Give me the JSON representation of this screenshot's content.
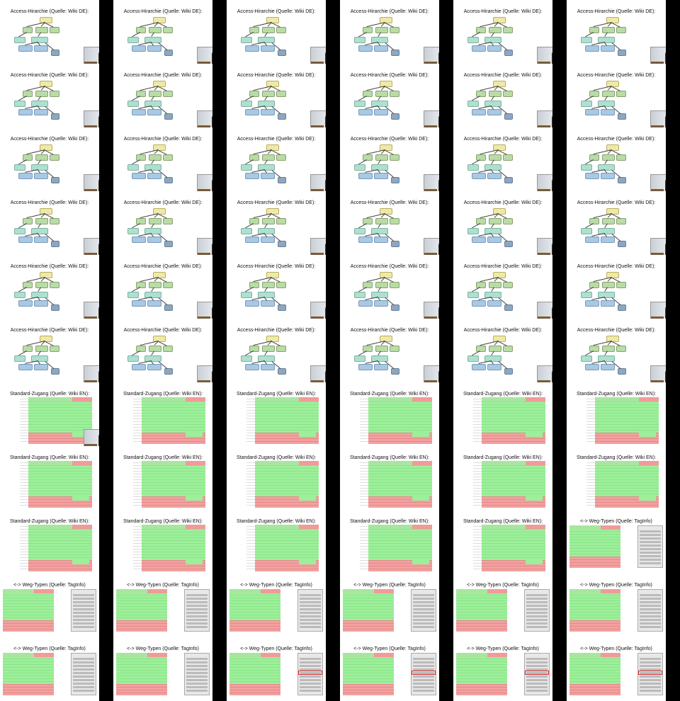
{
  "slides": {
    "access": {
      "title": "Access-Hirarchie (Quelle: Wiki DE):"
    },
    "standard": {
      "title": "Standard-Zugang (Quelle: Wiki EN):"
    },
    "weg": {
      "title": "<-> Weg-Typen (Quelle: TagInfo)"
    }
  },
  "layout_rows": [
    [
      "access",
      "access",
      "access",
      "access",
      "access",
      "access"
    ],
    [
      "access",
      "access",
      "access",
      "access",
      "access",
      "access"
    ],
    [
      "access",
      "access",
      "access",
      "access",
      "access",
      "access"
    ],
    [
      "access",
      "access",
      "access",
      "access",
      "access",
      "access"
    ],
    [
      "access",
      "access",
      "access",
      "access",
      "access",
      "access"
    ],
    [
      "access",
      "access",
      "access",
      "access",
      "access",
      "access"
    ],
    [
      "standard",
      "standard",
      "standard",
      "standard",
      "standard",
      "standard"
    ],
    [
      "standard",
      "standard",
      "standard",
      "standard",
      "standard",
      "standard"
    ],
    [
      "standard",
      "standard",
      "standard",
      "standard",
      "standard",
      "weg"
    ],
    [
      "weg",
      "weg",
      "weg",
      "weg",
      "weg",
      "weg"
    ],
    [
      "weg",
      "weg",
      "weg",
      "weg",
      "weg",
      "weg"
    ]
  ],
  "colors": {
    "background": "#000000",
    "slide": "#ffffff",
    "allowed_green": "#9cf09a",
    "denied_red": "#f3a0a0",
    "node_yellow": "#efe9a8",
    "node_green": "#b9dca6",
    "node_teal": "#aee0d0",
    "node_blue": "#a9c9e3"
  }
}
